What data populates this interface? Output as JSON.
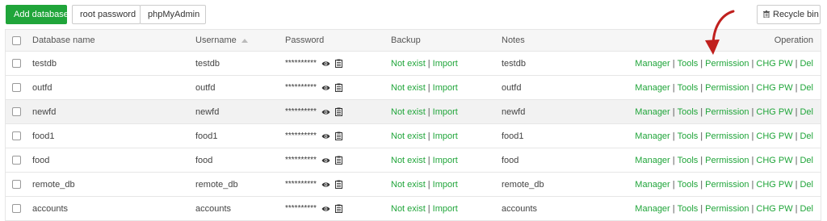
{
  "toolbar": {
    "add_database": "Add database",
    "root_password": "root password",
    "phpmyadmin": "phpMyAdmin",
    "recycle_bin": "Recycle bin"
  },
  "table": {
    "headers": {
      "database_name": "Database name",
      "username": "Username",
      "password": "Password",
      "backup": "Backup",
      "notes": "Notes",
      "operation": "Operation"
    },
    "rows": [
      {
        "name": "testdb",
        "username": "testdb",
        "password": "**********",
        "backup_status": "Not exist",
        "backup_import": "Import",
        "notes": "testdb"
      },
      {
        "name": "outfd",
        "username": "outfd",
        "password": "**********",
        "backup_status": "Not exist",
        "backup_import": "Import",
        "notes": "outfd"
      },
      {
        "name": "newfd",
        "username": "newfd",
        "password": "**********",
        "backup_status": "Not exist",
        "backup_import": "Import",
        "notes": "newfd"
      },
      {
        "name": "food1",
        "username": "food1",
        "password": "**********",
        "backup_status": "Not exist",
        "backup_import": "Import",
        "notes": "food1"
      },
      {
        "name": "food",
        "username": "food",
        "password": "**********",
        "backup_status": "Not exist",
        "backup_import": "Import",
        "notes": "food"
      },
      {
        "name": "remote_db",
        "username": "remote_db",
        "password": "**********",
        "backup_status": "Not exist",
        "backup_import": "Import",
        "notes": "remote_db"
      },
      {
        "name": "accounts",
        "username": "accounts",
        "password": "**********",
        "backup_status": "Not exist",
        "backup_import": "Import",
        "notes": "accounts"
      }
    ],
    "operations": {
      "manager": "Manager",
      "tools": "Tools",
      "permission": "Permission",
      "chg_pw": "CHG PW",
      "del": "Del"
    },
    "separator": "|",
    "highlighted_row": 3
  },
  "colors": {
    "accent": "#20a53a",
    "arrow": "#c0201e",
    "header_bg": "#f6f6f6",
    "row_highlight": "#f2f2f2"
  },
  "icons": {
    "recycle": "trash-icon",
    "show_password": "eye-icon",
    "copy_password": "clipboard-icon",
    "annotation": "red-curved-arrow"
  }
}
